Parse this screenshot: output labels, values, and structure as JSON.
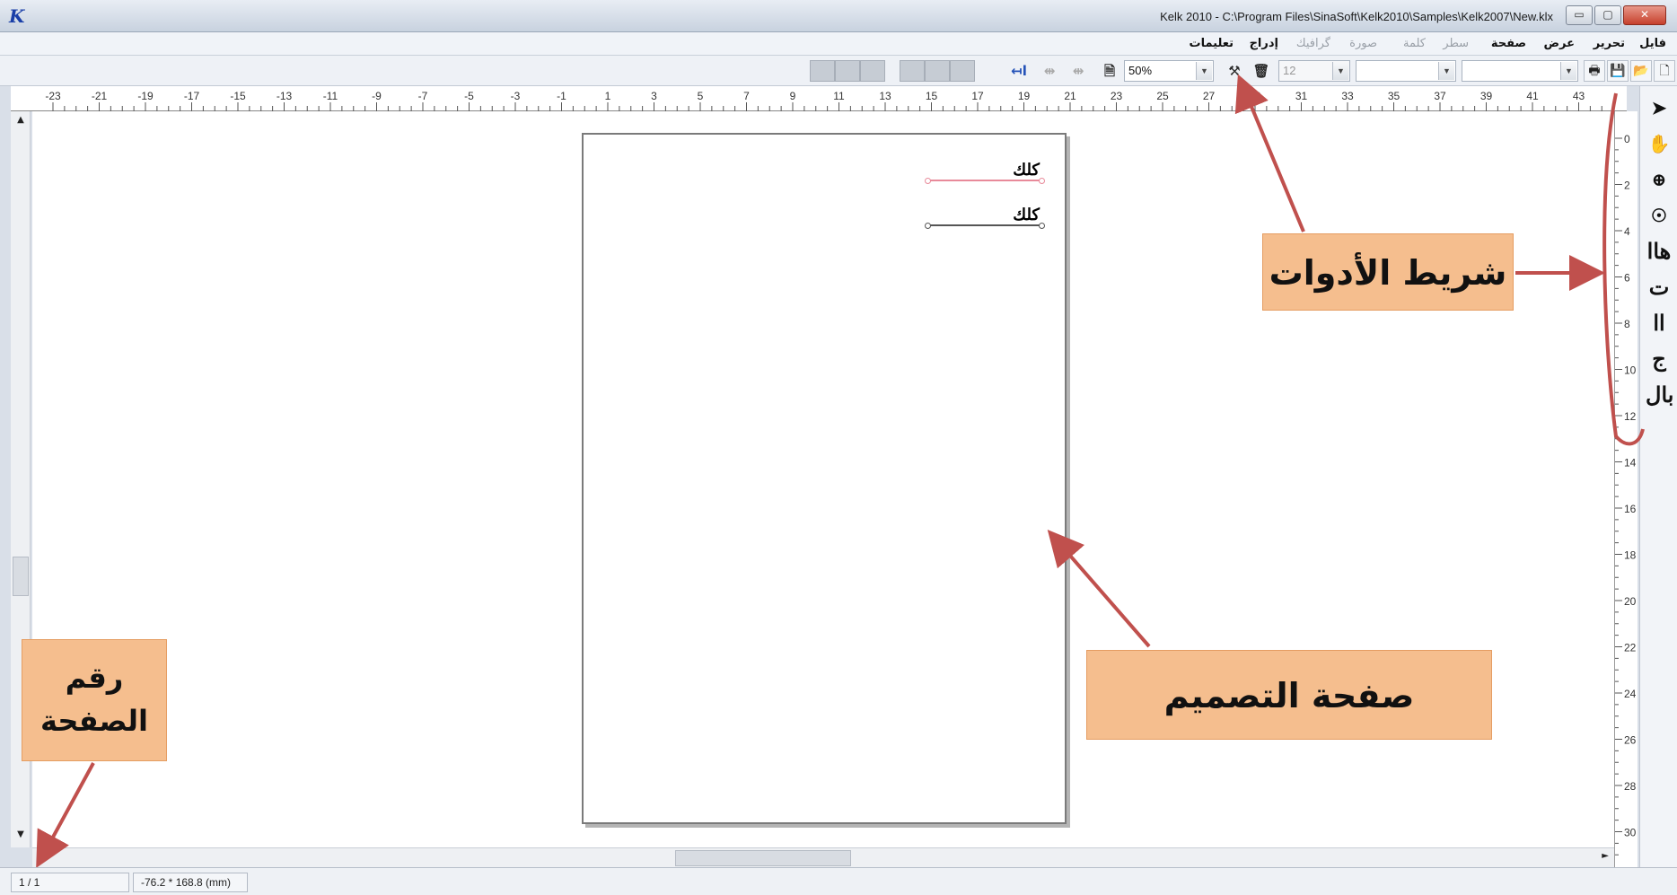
{
  "window": {
    "title": "Kelk 2010 - C:\\Program Files\\SinaSoft\\Kelk2010\\Samples\\Kelk2007\\New.klx",
    "logo_text": "K",
    "minimize_glyph": "▭",
    "maximize_glyph": "▢",
    "close_glyph": "✕"
  },
  "menu": {
    "items": [
      "فایل",
      "تحرير",
      "عرض",
      "صفحة",
      "سطر",
      "كلمة",
      "صورة",
      "گرافیك",
      "إدراج",
      "تعليمات"
    ],
    "enabled": [
      true,
      true,
      true,
      true,
      false,
      false,
      false,
      false,
      true,
      true
    ]
  },
  "toolbar": {
    "zoom_value": "50%",
    "font_size_value": "12",
    "font_name_value": "",
    "style_value": "",
    "dropdown_arrow": "▼",
    "icons": [
      "new-document-icon",
      "open-folder-icon",
      "save-icon",
      "print-icon",
      "delete-icon",
      "tools-icon",
      "page-icon",
      "align-icon"
    ],
    "glyphs": {
      "new": "🗋",
      "open": "📂",
      "save": "💾",
      "print": "🖶",
      "delete": "🗑",
      "tools": "⚒",
      "page": "🗎",
      "align_rtl": "↤ا",
      "align_center_a": "⇹",
      "align_center_b": "⇹"
    }
  },
  "hruler": {
    "labels": [
      "-23",
      "-21",
      "-19",
      "-17",
      "-15",
      "-13",
      "-11",
      "-9",
      "-7",
      "-5",
      "-3",
      "-1",
      "1",
      "3",
      "5",
      "7",
      "9",
      "11",
      "13",
      "15",
      "17",
      "19",
      "21",
      "23",
      "25",
      "27",
      "29",
      "31",
      "33",
      "35",
      "37",
      "39",
      "41",
      "43"
    ]
  },
  "vruler": {
    "labels": [
      "0",
      "2",
      "4",
      "6",
      "8",
      "10",
      "12",
      "14",
      "16",
      "18",
      "20",
      "22",
      "24",
      "26",
      "28",
      "30"
    ]
  },
  "tools": {
    "glyphs": [
      "➤",
      "✋",
      "⊕",
      "☉",
      "هاا",
      "ت",
      "اا",
      "ج",
      "بال"
    ],
    "names": [
      "pointer-tool-icon",
      "hand-tool-icon",
      "zoom-tool-icon",
      "rotate-tool-icon",
      "text-tool-icon-1",
      "text-tool-icon-2",
      "text-tool-icon-3",
      "text-tool-icon-4",
      "text-tool-icon-5"
    ]
  },
  "design_page": {
    "fields": [
      {
        "text": "كلك",
        "line_color": "#e88a9a"
      },
      {
        "text": "كلك",
        "line_color": "#555555"
      }
    ]
  },
  "scrollbar": {
    "up_arrow": "▲",
    "down_arrow": "▼",
    "right_arrow": "►"
  },
  "annotations": {
    "toolbar_label": "شريط الأدوات",
    "design_label": "صفحة التصميم",
    "pagenum_label_line1": "رقم",
    "pagenum_label_line2": "الصفحة",
    "arrow_color": "#c0504d"
  },
  "status": {
    "page": "1 / 1",
    "coords": "-76.2 * 168.8 (mm)"
  }
}
